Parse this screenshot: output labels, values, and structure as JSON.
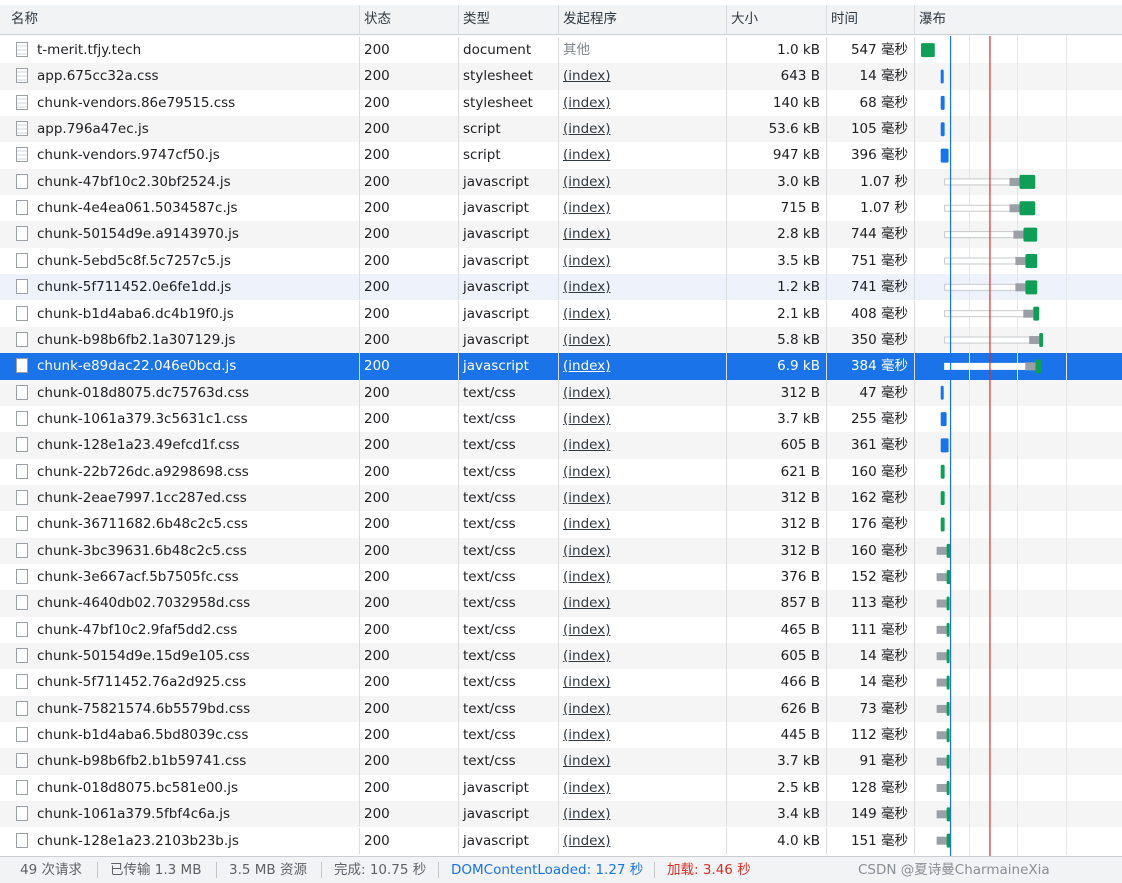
{
  "columns": {
    "name": "名称",
    "status": "状态",
    "type": "类型",
    "initiator": "发起程序",
    "size": "大小",
    "time": "时间",
    "waterfall": "瀑布"
  },
  "colors": {
    "selected": "#1a73e8",
    "dom_content_loaded_line": "#1a73e8",
    "load_line": "#d93025",
    "receive_green": "#0f9d58",
    "receive_blue": "#1a73e8"
  },
  "rows": [
    {
      "name": "t-merit.tfjy.tech",
      "status": "200",
      "type": "document",
      "initiator": "其他",
      "size": "1.0 kB",
      "time": "547 毫秒",
      "wf": [
        0.0,
        0.0,
        0.07
      ]
    },
    {
      "name": "app.675cc32a.css",
      "status": "200",
      "type": "stylesheet",
      "initiator": "(index)",
      "size": "643 B",
      "time": "14 毫秒",
      "wf": [
        0.1,
        0.1,
        0.11
      ]
    },
    {
      "name": "chunk-vendors.86e79515.css",
      "status": "200",
      "type": "stylesheet",
      "initiator": "(index)",
      "size": "140 kB",
      "time": "68 毫秒",
      "wf": [
        0.1,
        0.1,
        0.12
      ]
    },
    {
      "name": "app.796a47ec.js",
      "status": "200",
      "type": "script",
      "initiator": "(index)",
      "size": "53.6 kB",
      "time": "105 毫秒",
      "wf": [
        0.1,
        0.1,
        0.12
      ]
    },
    {
      "name": "chunk-vendors.9747cf50.js",
      "status": "200",
      "type": "script",
      "initiator": "(index)",
      "size": "947 kB",
      "time": "396 毫秒",
      "wf": [
        0.1,
        0.1,
        0.14
      ]
    },
    {
      "name": "chunk-47bf10c2.30bf2524.js",
      "status": "200",
      "type": "javascript",
      "initiator": "(index)",
      "size": "3.0 kB",
      "time": "1.07 秒",
      "wf": [
        0.12,
        0.5,
        0.58
      ]
    },
    {
      "name": "chunk-4e4ea061.5034587c.js",
      "status": "200",
      "type": "javascript",
      "initiator": "(index)",
      "size": "715 B",
      "time": "1.07 秒",
      "wf": [
        0.12,
        0.5,
        0.58
      ]
    },
    {
      "name": "chunk-50154d9e.a9143970.js",
      "status": "200",
      "type": "javascript",
      "initiator": "(index)",
      "size": "2.8 kB",
      "time": "744 毫秒",
      "wf": [
        0.12,
        0.52,
        0.59
      ]
    },
    {
      "name": "chunk-5ebd5c8f.5c7257c5.js",
      "status": "200",
      "type": "javascript",
      "initiator": "(index)",
      "size": "3.5 kB",
      "time": "751 毫秒",
      "wf": [
        0.12,
        0.53,
        0.59
      ]
    },
    {
      "name": "chunk-5f711452.0e6fe1dd.js",
      "status": "200",
      "type": "javascript",
      "initiator": "(index)",
      "size": "1.2 kB",
      "time": "741 毫秒",
      "wf": [
        0.12,
        0.53,
        0.59
      ]
    },
    {
      "name": "chunk-b1d4aba6.dc4b19f0.js",
      "status": "200",
      "type": "javascript",
      "initiator": "(index)",
      "size": "2.1 kB",
      "time": "408 毫秒",
      "wf": [
        0.12,
        0.57,
        0.6
      ]
    },
    {
      "name": "chunk-b98b6fb2.1a307129.js",
      "status": "200",
      "type": "javascript",
      "initiator": "(index)",
      "size": "5.8 kB",
      "time": "350 毫秒",
      "wf": [
        0.12,
        0.6,
        0.62
      ]
    },
    {
      "name": "chunk-e89dac22.046e0bcd.js",
      "status": "200",
      "type": "javascript",
      "initiator": "(index)",
      "size": "6.9 kB",
      "time": "384 毫秒",
      "wf": [
        0.12,
        0.58,
        0.61
      ]
    },
    {
      "name": "chunk-018d8075.dc75763d.css",
      "status": "200",
      "type": "text/css",
      "initiator": "(index)",
      "size": "312 B",
      "time": "47 毫秒",
      "wf": [
        0.1,
        0.1,
        0.11
      ]
    },
    {
      "name": "chunk-1061a379.3c5631c1.css",
      "status": "200",
      "type": "text/css",
      "initiator": "(index)",
      "size": "3.7 kB",
      "time": "255 毫秒",
      "wf": [
        0.1,
        0.1,
        0.13
      ]
    },
    {
      "name": "chunk-128e1a23.49efcd1f.css",
      "status": "200",
      "type": "text/css",
      "initiator": "(index)",
      "size": "605 B",
      "time": "361 毫秒",
      "wf": [
        0.1,
        0.1,
        0.14
      ]
    },
    {
      "name": "chunk-22b726dc.a9298698.css",
      "status": "200",
      "type": "text/css",
      "initiator": "(index)",
      "size": "621 B",
      "time": "160 毫秒",
      "wf": [
        0.1,
        0.1,
        0.12
      ]
    },
    {
      "name": "chunk-2eae7997.1cc287ed.css",
      "status": "200",
      "type": "text/css",
      "initiator": "(index)",
      "size": "312 B",
      "time": "162 毫秒",
      "wf": [
        0.1,
        0.1,
        0.12
      ]
    },
    {
      "name": "chunk-36711682.6b48c2c5.css",
      "status": "200",
      "type": "text/css",
      "initiator": "(index)",
      "size": "312 B",
      "time": "176 毫秒",
      "wf": [
        0.1,
        0.1,
        0.12
      ]
    },
    {
      "name": "chunk-3bc39631.6b48c2c5.css",
      "status": "200",
      "type": "text/css",
      "initiator": "(index)",
      "size": "312 B",
      "time": "160 毫秒",
      "wf": [
        0.11,
        0.13,
        0.15
      ]
    },
    {
      "name": "chunk-3e667acf.5b7505fc.css",
      "status": "200",
      "type": "text/css",
      "initiator": "(index)",
      "size": "376 B",
      "time": "152 毫秒",
      "wf": [
        0.11,
        0.13,
        0.15
      ]
    },
    {
      "name": "chunk-4640db02.7032958d.css",
      "status": "200",
      "type": "text/css",
      "initiator": "(index)",
      "size": "857 B",
      "time": "113 毫秒",
      "wf": [
        0.11,
        0.13,
        0.145
      ]
    },
    {
      "name": "chunk-47bf10c2.9faf5dd2.css",
      "status": "200",
      "type": "text/css",
      "initiator": "(index)",
      "size": "465 B",
      "time": "111 毫秒",
      "wf": [
        0.11,
        0.13,
        0.145
      ]
    },
    {
      "name": "chunk-50154d9e.15d9e105.css",
      "status": "200",
      "type": "text/css",
      "initiator": "(index)",
      "size": "605 B",
      "time": "14 毫秒",
      "wf": [
        0.11,
        0.13,
        0.14
      ]
    },
    {
      "name": "chunk-5f711452.76a2d925.css",
      "status": "200",
      "type": "text/css",
      "initiator": "(index)",
      "size": "466 B",
      "time": "14 毫秒",
      "wf": [
        0.11,
        0.13,
        0.14
      ]
    },
    {
      "name": "chunk-75821574.6b5579bd.css",
      "status": "200",
      "type": "text/css",
      "initiator": "(index)",
      "size": "626 B",
      "time": "73 毫秒",
      "wf": [
        0.11,
        0.13,
        0.14
      ]
    },
    {
      "name": "chunk-b1d4aba6.5bd8039c.css",
      "status": "200",
      "type": "text/css",
      "initiator": "(index)",
      "size": "445 B",
      "time": "112 毫秒",
      "wf": [
        0.11,
        0.13,
        0.145
      ]
    },
    {
      "name": "chunk-b98b6fb2.b1b59741.css",
      "status": "200",
      "type": "text/css",
      "initiator": "(index)",
      "size": "3.7 kB",
      "time": "91 毫秒",
      "wf": [
        0.11,
        0.13,
        0.14
      ]
    },
    {
      "name": "chunk-018d8075.bc581e00.js",
      "status": "200",
      "type": "javascript",
      "initiator": "(index)",
      "size": "2.5 kB",
      "time": "128 毫秒",
      "wf": [
        0.11,
        0.13,
        0.145
      ]
    },
    {
      "name": "chunk-1061a379.5fbf4c6a.js",
      "status": "200",
      "type": "javascript",
      "initiator": "(index)",
      "size": "3.4 kB",
      "time": "149 毫秒",
      "wf": [
        0.11,
        0.13,
        0.15
      ]
    },
    {
      "name": "chunk-128e1a23.2103b23b.js",
      "status": "200",
      "type": "javascript",
      "initiator": "(index)",
      "size": "4.0 kB",
      "time": "151 毫秒",
      "wf": [
        0.11,
        0.13,
        0.15
      ]
    }
  ],
  "selected_row": 12,
  "hover_row": 9,
  "waterfall_markers": {
    "dom_content_loaded": 0.15,
    "load": 0.35
  },
  "footer": {
    "requests": "49 次请求",
    "transferred": "已传输 1.3 MB",
    "resources": "3.5 MB 资源",
    "finish": "完成: 10.75 秒",
    "dom_content_loaded": "DOMContentLoaded: 1.27 秒",
    "load": "加载: 3.46 秒"
  },
  "watermark": "CSDN @夏诗曼CharmaineXia"
}
